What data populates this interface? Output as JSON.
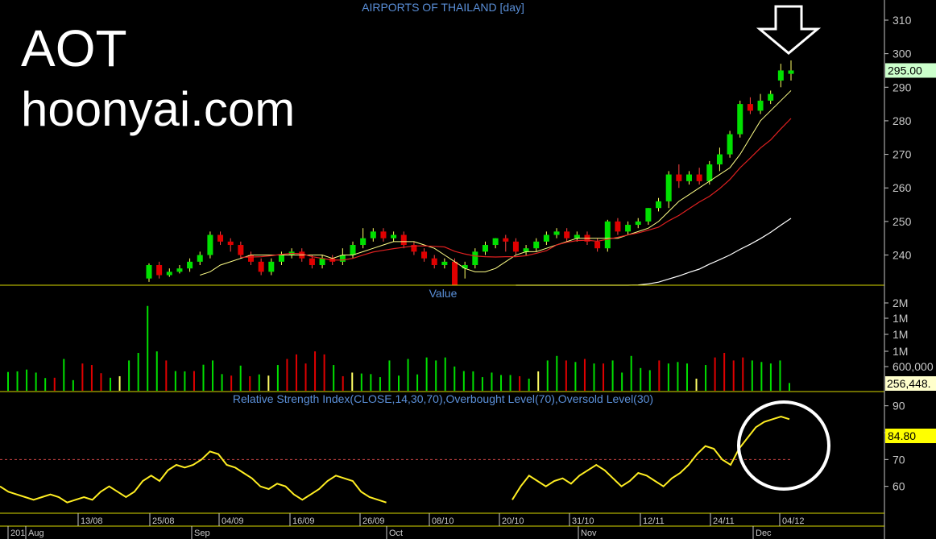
{
  "overlay": {
    "ticker": "AOT",
    "website": "hoonyai.com"
  },
  "colors": {
    "background": "#000000",
    "up": "#00e000",
    "down": "#e00000",
    "neutral": "#ffff66",
    "ma_fast": "#ffff88",
    "ma_mid": "#e02020",
    "ma_slow": "#ffffff",
    "rsi": "#ffee22",
    "title": "#5a8fd8",
    "axis": "#c8c8c8",
    "separator": "#d8d800"
  },
  "chart_data": [
    {
      "type": "candlestick",
      "title": "AIRPORTS OF THAILAND [day]",
      "ylim": [
        231,
        316
      ],
      "yticks": [
        240,
        250,
        260,
        270,
        280,
        290,
        300,
        310
      ],
      "last_value_label": "295.00",
      "last_value": 295,
      "candles": [
        [
          233,
          237,
          232,
          237.5
        ],
        [
          237,
          234,
          233,
          238
        ],
        [
          234,
          235,
          233.5,
          236
        ],
        [
          235,
          236,
          234.5,
          237
        ],
        [
          236,
          238,
          235,
          239
        ],
        [
          238,
          240,
          237,
          241
        ],
        [
          240,
          246,
          239,
          247
        ],
        [
          246,
          244,
          243,
          247
        ],
        [
          244,
          243,
          241,
          245
        ],
        [
          243,
          240,
          239,
          244
        ],
        [
          240,
          238,
          237,
          241
        ],
        [
          238,
          235,
          234,
          239
        ],
        [
          235,
          238,
          234,
          239
        ],
        [
          238,
          240,
          237,
          241
        ],
        [
          240,
          241,
          239,
          242
        ],
        [
          241,
          239,
          238,
          242
        ],
        [
          239,
          237,
          236,
          240
        ],
        [
          237,
          239,
          236,
          240
        ],
        [
          239,
          238,
          237,
          240
        ],
        [
          238,
          240,
          237,
          242
        ],
        [
          240,
          243,
          239,
          244
        ],
        [
          243,
          245,
          242,
          248
        ],
        [
          245,
          247,
          244,
          248
        ],
        [
          247,
          245,
          244,
          248
        ],
        [
          245,
          246,
          244,
          247
        ],
        [
          246,
          243,
          242,
          247
        ],
        [
          243,
          241,
          240,
          244
        ],
        [
          241,
          239,
          238,
          242
        ],
        [
          239,
          237,
          236,
          240
        ],
        [
          237,
          238,
          236,
          239
        ],
        [
          238,
          230,
          229,
          239
        ],
        [
          236,
          237,
          233,
          238
        ],
        [
          237,
          241,
          236,
          242
        ],
        [
          241,
          243,
          240,
          244
        ],
        [
          243,
          245,
          242,
          245
        ],
        [
          245,
          244,
          241,
          246
        ],
        [
          244,
          241,
          240,
          245
        ],
        [
          241,
          242,
          240,
          243
        ],
        [
          242,
          244,
          241,
          245
        ],
        [
          244,
          246,
          243,
          247
        ],
        [
          246,
          247,
          245,
          248
        ],
        [
          247,
          245,
          244,
          248
        ],
        [
          245,
          246,
          244,
          247
        ],
        [
          246,
          244,
          243,
          247
        ],
        [
          244,
          242,
          241,
          245
        ],
        [
          242,
          250,
          241,
          250.5
        ],
        [
          250,
          247,
          246,
          251
        ],
        [
          247,
          249,
          246,
          250
        ],
        [
          249,
          250,
          248,
          251
        ],
        [
          250,
          254,
          249,
          254
        ],
        [
          254,
          256,
          253,
          257
        ],
        [
          256,
          264,
          254,
          265
        ],
        [
          264,
          262,
          260,
          267
        ],
        [
          262,
          264,
          261,
          265
        ],
        [
          264,
          262,
          261,
          266
        ],
        [
          262,
          267,
          261,
          268
        ],
        [
          267,
          270,
          265,
          272
        ],
        [
          270,
          276,
          269,
          277
        ],
        [
          276,
          285,
          275,
          286
        ],
        [
          285,
          283,
          282,
          287
        ],
        [
          283,
          286,
          282,
          288
        ],
        [
          286,
          288,
          285,
          289
        ],
        [
          292,
          295,
          290,
          297
        ],
        [
          294,
          295,
          292,
          298
        ]
      ],
      "moving_averages": {
        "fast": [
          null,
          null,
          null,
          null,
          null,
          234,
          235,
          237,
          238,
          239,
          240,
          240,
          240,
          240,
          240,
          240,
          240,
          240,
          239,
          240,
          240,
          241,
          242,
          243,
          244,
          244,
          244,
          243,
          242,
          240,
          238,
          236,
          235,
          235,
          236,
          238,
          240,
          241,
          241,
          242,
          243,
          244,
          245,
          245,
          245,
          245,
          245,
          246,
          247,
          248,
          250,
          253,
          256,
          258,
          260,
          262,
          264,
          266,
          270,
          275,
          280,
          283,
          286,
          289
        ],
        "mid": [
          null,
          null,
          null,
          null,
          null,
          null,
          null,
          null,
          null,
          null,
          null,
          null,
          null,
          null,
          null,
          null,
          null,
          null,
          null,
          null,
          null,
          null,
          null,
          null,
          null,
          null,
          null,
          null,
          null,
          null,
          null,
          null,
          null,
          null,
          null,
          null,
          null,
          null,
          null,
          null,
          null,
          null,
          null,
          null,
          null,
          null,
          null,
          null,
          null,
          null,
          null,
          null,
          null,
          null,
          null,
          null,
          null,
          null,
          null,
          null,
          null,
          null,
          null,
          null
        ]
      }
    },
    {
      "type": "bar",
      "title": "Value",
      "yticks_labels": [
        "600,000",
        "1M",
        "1M",
        "1M",
        "2M"
      ],
      "last_value_label": "256,448.",
      "max_value": 2900000,
      "values": [
        620000,
        640000,
        700000,
        600000,
        420000,
        430000,
        1050000,
        350000,
        900000,
        850000,
        580000,
        430000,
        480000,
        1000000,
        1250000,
        2800000,
        1300000,
        1000000,
        650000,
        640000,
        650000,
        860000,
        1000000,
        550000,
        500000,
        830000,
        480000,
        540000,
        500000,
        850000,
        1050000,
        1200000,
        900000,
        1300000,
        1200000,
        850000,
        480000,
        600000,
        570000,
        550000,
        450000,
        1000000,
        500000,
        1050000,
        540000,
        1100000,
        1000000,
        1100000,
        800000,
        650000,
        640000,
        450000,
        600000,
        520000,
        520000,
        480000,
        400000,
        640000,
        1000000,
        1150000,
        1000000,
        950000,
        1050000,
        900000,
        900000,
        1000000,
        600000,
        1150000,
        750000,
        680000,
        1000000,
        900000,
        950000,
        900000,
        400000,
        850000,
        1100000,
        1250000,
        1000000,
        1100000,
        1000000,
        950000,
        900000,
        1000000,
        256448
      ],
      "colors_per_bar": [
        "g",
        "g",
        "g",
        "g",
        "g",
        "r",
        "g",
        "g",
        "r",
        "r",
        "r",
        "g",
        "y",
        "g",
        "g",
        "g",
        "g",
        "r",
        "g",
        "g",
        "r",
        "g",
        "g",
        "g",
        "r",
        "g",
        "r",
        "g",
        "y",
        "g",
        "r",
        "r",
        "r",
        "r",
        "r",
        "g",
        "r",
        "y",
        "g",
        "g",
        "g",
        "g",
        "g",
        "g",
        "g",
        "g",
        "g",
        "g",
        "g",
        "g",
        "g",
        "g",
        "g",
        "g",
        "g",
        "r",
        "g",
        "y",
        "g",
        "g",
        "r",
        "g",
        "r",
        "g",
        "r",
        "g",
        "g",
        "g",
        "g",
        "g",
        "r",
        "g",
        "g",
        "g",
        "y",
        "g",
        "r",
        "r",
        "r",
        "r",
        "g",
        "g",
        "g",
        "g",
        "g"
      ]
    },
    {
      "type": "line",
      "title": "Relative Strength Index(CLOSE,14,30,70),Overbought Level(70),Oversold Level(30)",
      "ylim": [
        50,
        95
      ],
      "yticks": [
        60,
        70,
        80,
        90
      ],
      "overbought": 70,
      "last_value_label": "84.80",
      "last_value": 84.8,
      "values": [
        60,
        58,
        57,
        56,
        55,
        56,
        57,
        56,
        54,
        55,
        56,
        55,
        58,
        60,
        58,
        56,
        58,
        62,
        64,
        62,
        66,
        68,
        67,
        68,
        70,
        73,
        72,
        68,
        67,
        65,
        63,
        60,
        59,
        61,
        60,
        57,
        55,
        57,
        59,
        62,
        64,
        63,
        62,
        58,
        56,
        55,
        54,
        null,
        null,
        null,
        null,
        null,
        null,
        null,
        null,
        null,
        null,
        null,
        null,
        null,
        null,
        55,
        60,
        64,
        62,
        60,
        62,
        63,
        61,
        64,
        66,
        68,
        66,
        63,
        60,
        62,
        65,
        64,
        62,
        60,
        63,
        65,
        68,
        72,
        75,
        74,
        70,
        68,
        74,
        78,
        82,
        84,
        85,
        86,
        85
      ]
    }
  ],
  "x_axis": {
    "day_labels": [
      "13/08",
      "25/08",
      "04/09",
      "16/09",
      "26/09",
      "08/10",
      "20/10",
      "31/10",
      "12/11",
      "24/11",
      "04/12"
    ],
    "month_labels": [
      "201",
      "Aug",
      "Sep",
      "Oct",
      "Nov",
      "Dec"
    ]
  }
}
